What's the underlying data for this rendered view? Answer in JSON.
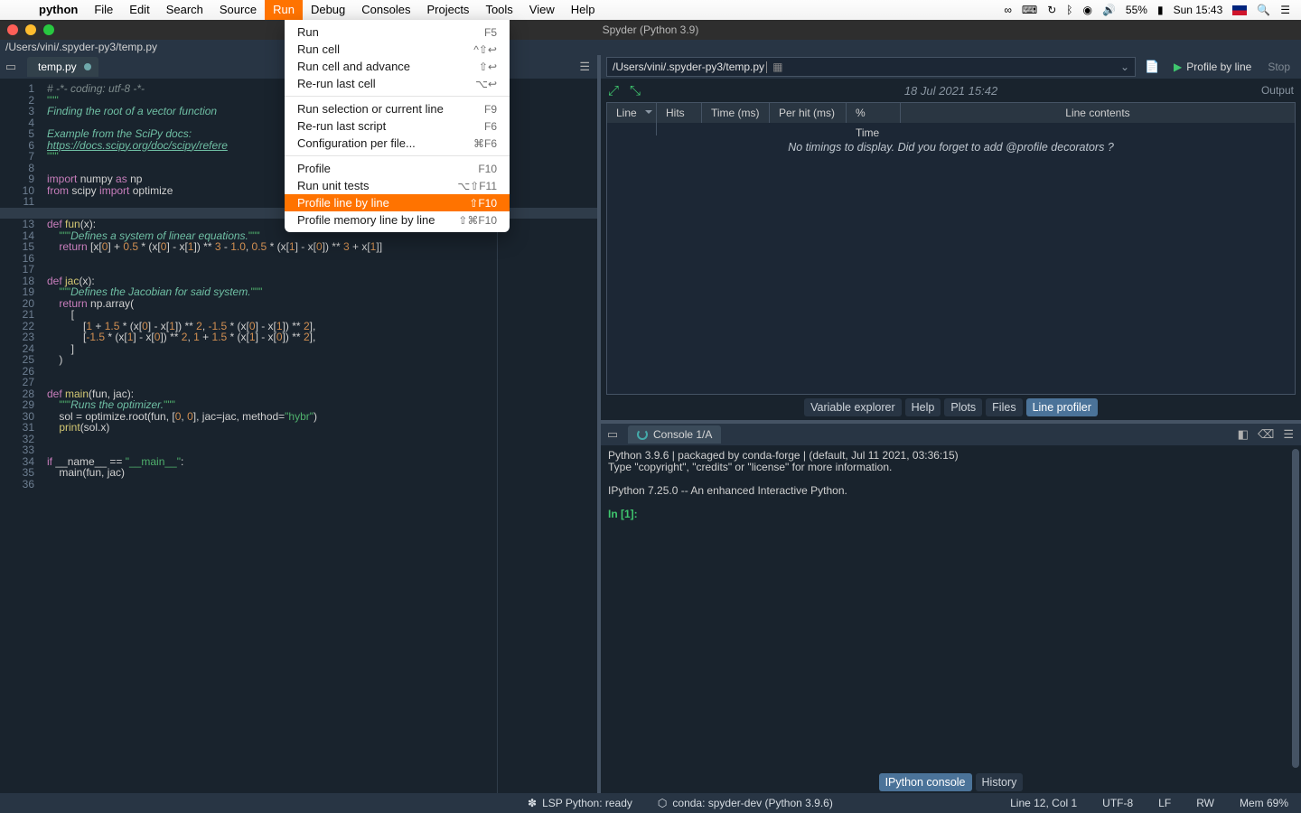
{
  "mac_menu": {
    "app": "python",
    "items": [
      "File",
      "Edit",
      "Search",
      "Source",
      "Run",
      "Debug",
      "Consoles",
      "Projects",
      "Tools",
      "View",
      "Help"
    ],
    "active": "Run",
    "right": {
      "battery_pct": "55%",
      "day_time": "Sun 15:43"
    }
  },
  "window_title": "Spyder (Python 3.9)",
  "path_display": "/Users/vini/.spyder-py3/temp.py",
  "editor": {
    "tab_name": "temp.py",
    "current_line": 12,
    "lines": [
      {
        "n": 1,
        "segs": [
          [
            "c-cmt",
            "# -*- coding: utf-8 -*-"
          ]
        ]
      },
      {
        "n": 2,
        "segs": [
          [
            "c-str",
            "\"\"\""
          ]
        ]
      },
      {
        "n": 3,
        "segs": [
          [
            "c-doc",
            "Finding the root of a vector function"
          ]
        ]
      },
      {
        "n": 4,
        "segs": [
          [
            "",
            ""
          ]
        ]
      },
      {
        "n": 5,
        "segs": [
          [
            "c-doc",
            "Example from the SciPy docs:"
          ]
        ]
      },
      {
        "n": 6,
        "segs": [
          [
            "c-link",
            "https://docs.scipy.org/doc/scipy/refere"
          ]
        ]
      },
      {
        "n": 7,
        "segs": [
          [
            "c-str",
            "\"\"\""
          ]
        ]
      },
      {
        "n": 8,
        "segs": [
          [
            "",
            ""
          ]
        ]
      },
      {
        "n": 9,
        "segs": [
          [
            "c-kw",
            "import "
          ],
          [
            "c-id",
            "numpy "
          ],
          [
            "c-kw",
            "as "
          ],
          [
            "c-id",
            "np"
          ]
        ]
      },
      {
        "n": 10,
        "segs": [
          [
            "c-kw",
            "from "
          ],
          [
            "c-id",
            "scipy "
          ],
          [
            "c-kw",
            "import "
          ],
          [
            "c-id",
            "optimize"
          ]
        ]
      },
      {
        "n": 11,
        "segs": [
          [
            "",
            ""
          ]
        ]
      },
      {
        "n": 12,
        "segs": [
          [
            "",
            ""
          ]
        ]
      },
      {
        "n": 13,
        "segs": [
          [
            "c-kw",
            "def "
          ],
          [
            "c-fn",
            "fun"
          ],
          [
            "c-op",
            "(x):"
          ]
        ]
      },
      {
        "n": 14,
        "segs": [
          [
            "",
            "    "
          ],
          [
            "c-str",
            "\"\"\""
          ],
          [
            "c-doc",
            "Defines a system of linear equations."
          ],
          [
            "c-str",
            "\"\"\""
          ]
        ]
      },
      {
        "n": 15,
        "segs": [
          [
            "",
            "    "
          ],
          [
            "c-kw",
            "return "
          ],
          [
            "c-op",
            "[x["
          ],
          [
            "c-num",
            "0"
          ],
          [
            "c-op",
            "] + "
          ],
          [
            "c-num",
            "0.5"
          ],
          [
            "c-op",
            " * (x["
          ],
          [
            "c-num",
            "0"
          ],
          [
            "c-op",
            "] - x["
          ],
          [
            "c-num",
            "1"
          ],
          [
            "c-op",
            "]) ** "
          ],
          [
            "c-num",
            "3"
          ],
          [
            "c-op",
            " - "
          ],
          [
            "c-num",
            "1.0"
          ],
          [
            "c-op",
            ", "
          ],
          [
            "c-num",
            "0.5"
          ],
          [
            "c-op",
            " * (x["
          ],
          [
            "c-num",
            "1"
          ],
          [
            "c-op",
            "] - x["
          ],
          [
            "c-num",
            "0"
          ],
          [
            "c-op",
            "]) ** "
          ],
          [
            "c-num",
            "3"
          ],
          [
            "c-op",
            " + x["
          ],
          [
            "c-num",
            "1"
          ],
          [
            "c-op",
            "]]"
          ]
        ]
      },
      {
        "n": 16,
        "segs": [
          [
            "",
            ""
          ]
        ]
      },
      {
        "n": 17,
        "segs": [
          [
            "",
            ""
          ]
        ]
      },
      {
        "n": 18,
        "segs": [
          [
            "c-kw",
            "def "
          ],
          [
            "c-fn",
            "jac"
          ],
          [
            "c-op",
            "(x):"
          ]
        ]
      },
      {
        "n": 19,
        "segs": [
          [
            "",
            "    "
          ],
          [
            "c-str",
            "\"\"\""
          ],
          [
            "c-doc",
            "Defines the Jacobian for said system."
          ],
          [
            "c-str",
            "\"\"\""
          ]
        ]
      },
      {
        "n": 20,
        "segs": [
          [
            "",
            "    "
          ],
          [
            "c-kw",
            "return "
          ],
          [
            "c-id",
            "np.array"
          ],
          [
            "c-op",
            "("
          ]
        ]
      },
      {
        "n": 21,
        "segs": [
          [
            "",
            "        "
          ],
          [
            "c-op",
            "["
          ]
        ]
      },
      {
        "n": 22,
        "segs": [
          [
            "",
            "            "
          ],
          [
            "c-op",
            "["
          ],
          [
            "c-num",
            "1"
          ],
          [
            "c-op",
            " + "
          ],
          [
            "c-num",
            "1.5"
          ],
          [
            "c-op",
            " * (x["
          ],
          [
            "c-num",
            "0"
          ],
          [
            "c-op",
            "] - x["
          ],
          [
            "c-num",
            "1"
          ],
          [
            "c-op",
            "]) ** "
          ],
          [
            "c-num",
            "2"
          ],
          [
            "c-op",
            ", "
          ],
          [
            "c-num",
            "-1.5"
          ],
          [
            "c-op",
            " * (x["
          ],
          [
            "c-num",
            "0"
          ],
          [
            "c-op",
            "] - x["
          ],
          [
            "c-num",
            "1"
          ],
          [
            "c-op",
            "]) ** "
          ],
          [
            "c-num",
            "2"
          ],
          [
            "c-op",
            "],"
          ]
        ]
      },
      {
        "n": 23,
        "segs": [
          [
            "",
            "            "
          ],
          [
            "c-op",
            "["
          ],
          [
            "c-num",
            "-1.5"
          ],
          [
            "c-op",
            " * (x["
          ],
          [
            "c-num",
            "1"
          ],
          [
            "c-op",
            "] - x["
          ],
          [
            "c-num",
            "0"
          ],
          [
            "c-op",
            "]) ** "
          ],
          [
            "c-num",
            "2"
          ],
          [
            "c-op",
            ", "
          ],
          [
            "c-num",
            "1"
          ],
          [
            "c-op",
            " + "
          ],
          [
            "c-num",
            "1.5"
          ],
          [
            "c-op",
            " * (x["
          ],
          [
            "c-num",
            "1"
          ],
          [
            "c-op",
            "] - x["
          ],
          [
            "c-num",
            "0"
          ],
          [
            "c-op",
            "]) ** "
          ],
          [
            "c-num",
            "2"
          ],
          [
            "c-op",
            "],"
          ]
        ]
      },
      {
        "n": 24,
        "segs": [
          [
            "",
            "        "
          ],
          [
            "c-op",
            "]"
          ]
        ]
      },
      {
        "n": 25,
        "segs": [
          [
            "",
            "    "
          ],
          [
            "c-op",
            ")"
          ]
        ]
      },
      {
        "n": 26,
        "segs": [
          [
            "",
            ""
          ]
        ]
      },
      {
        "n": 27,
        "segs": [
          [
            "",
            ""
          ]
        ]
      },
      {
        "n": 28,
        "segs": [
          [
            "c-kw",
            "def "
          ],
          [
            "c-fn",
            "main"
          ],
          [
            "c-op",
            "(fun, jac):"
          ]
        ]
      },
      {
        "n": 29,
        "segs": [
          [
            "",
            "    "
          ],
          [
            "c-str",
            "\"\"\""
          ],
          [
            "c-doc",
            "Runs the optimizer."
          ],
          [
            "c-str",
            "\"\"\""
          ]
        ]
      },
      {
        "n": 30,
        "segs": [
          [
            "",
            "    "
          ],
          [
            "c-id",
            "sol = optimize.root(fun, ["
          ],
          [
            "c-num",
            "0"
          ],
          [
            "c-op",
            ", "
          ],
          [
            "c-num",
            "0"
          ],
          [
            "c-id",
            "], jac=jac, method="
          ],
          [
            "c-str",
            "\"hybr\""
          ],
          [
            "c-op",
            ")"
          ]
        ]
      },
      {
        "n": 31,
        "segs": [
          [
            "",
            "    "
          ],
          [
            "c-fn",
            "print"
          ],
          [
            "c-op",
            "(sol.x)"
          ]
        ]
      },
      {
        "n": 32,
        "segs": [
          [
            "",
            ""
          ]
        ]
      },
      {
        "n": 33,
        "segs": [
          [
            "",
            ""
          ]
        ]
      },
      {
        "n": 34,
        "segs": [
          [
            "c-kw",
            "if "
          ],
          [
            "c-id",
            "__name__ "
          ],
          [
            "c-op",
            "== "
          ],
          [
            "c-str",
            "\"__main__\""
          ],
          [
            "c-op",
            ":"
          ]
        ]
      },
      {
        "n": 35,
        "segs": [
          [
            "",
            "    "
          ],
          [
            "c-id",
            "main(fun, jac)"
          ]
        ]
      },
      {
        "n": 36,
        "segs": [
          [
            "",
            ""
          ]
        ]
      }
    ]
  },
  "profiler": {
    "filepath": "/Users/vini/.spyder-py3/temp.py",
    "run_label": "Profile by line",
    "stop_label": "Stop",
    "timestamp": "18 Jul 2021 15:42",
    "output_label": "Output",
    "columns": [
      "Line",
      "Hits",
      "Time (ms)",
      "Per hit (ms)",
      "% Time",
      "Line contents"
    ],
    "empty_msg": "No timings to display. Did you forget to add @profile decorators ?"
  },
  "panes_top": [
    "Variable explorer",
    "Help",
    "Plots",
    "Files",
    "Line profiler"
  ],
  "panes_top_active": "Line profiler",
  "console": {
    "tab": "Console 1/A",
    "text": "Python 3.9.6 | packaged by conda-forge | (default, Jul 11 2021, 03:36:15)\nType \"copyright\", \"credits\" or \"license\" for more information.\n\nIPython 7.25.0 -- An enhanced Interactive Python.\n",
    "prompt": "In [1]: "
  },
  "panes_bottom": [
    "IPython console",
    "History"
  ],
  "panes_bottom_active": "IPython console",
  "status": {
    "lsp": "LSP Python: ready",
    "conda": "conda: spyder-dev (Python 3.9.6)",
    "cursor": "Line 12, Col 1",
    "encoding": "UTF-8",
    "eol": "LF",
    "rw": "RW",
    "mem": "Mem 69%"
  },
  "dropdown": {
    "groups": [
      [
        {
          "label": "Run",
          "shortcut": "F5"
        },
        {
          "label": "Run cell",
          "shortcut": "^⇧↩"
        },
        {
          "label": "Run cell and advance",
          "shortcut": "⇧↩"
        },
        {
          "label": "Re-run last cell",
          "shortcut": "⌥↩"
        }
      ],
      [
        {
          "label": "Run selection or current line",
          "shortcut": "F9"
        },
        {
          "label": "Re-run last script",
          "shortcut": "F6"
        },
        {
          "label": "Configuration per file...",
          "shortcut": "⌘F6"
        }
      ],
      [
        {
          "label": "Profile",
          "shortcut": "F10"
        },
        {
          "label": "Run unit tests",
          "shortcut": "⌥⇧F11"
        },
        {
          "label": "Profile line by line",
          "shortcut": "⇧F10",
          "hl": true
        },
        {
          "label": "Profile memory line by line",
          "shortcut": "⇧⌘F10"
        }
      ]
    ]
  }
}
